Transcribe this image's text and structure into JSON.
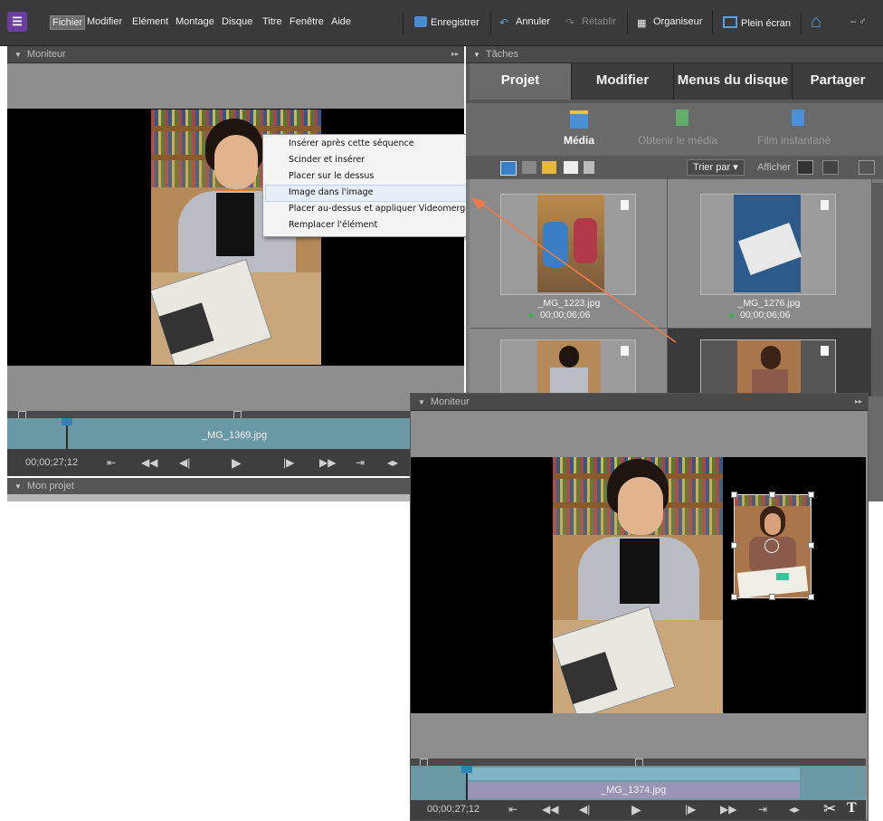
{
  "menubar": {
    "items": [
      "Fichier",
      "Modifier",
      "Elément",
      "Montage",
      "Disque",
      "Titre",
      "Fenêtre",
      "Aide"
    ],
    "active_index": 0,
    "toolbar": {
      "save": "Enregistrer",
      "undo": "Annuler",
      "redo": "Rétablir",
      "organizer": "Organiseur",
      "fullscreen": "Plein écran",
      "window_controls": "– ♂"
    }
  },
  "monitor_panel": {
    "title": "Moniteur",
    "clip_name": "_MG_1369.jpg",
    "timecode": "00;00;27;12"
  },
  "context_menu": {
    "items": [
      "Insérer après cette séquence",
      "Scinder et insérer",
      "Placer sur le dessus",
      "Image dans l'image",
      "Placer au-dessus et appliquer Videomerge",
      "Remplacer l'élément"
    ],
    "highlighted_index": 3
  },
  "project_panel": {
    "title": "Mon projet"
  },
  "tasks_panel": {
    "title": "Tâches",
    "tabs": [
      "Projet",
      "Modifier",
      "Menus du disque",
      "Partager"
    ],
    "selected_tab": 0,
    "subtabs": [
      "Média",
      "Obtenir le média",
      "Film instantané"
    ],
    "sort_label": "Trier par",
    "view_label": "Afficher",
    "thumbnails": [
      {
        "name": "_MG_1223.jpg",
        "duration": "00;00;06;06"
      },
      {
        "name": "_MG_1276.jpg",
        "duration": "00;00;06;06"
      }
    ]
  },
  "monitor2": {
    "title": "Moniteur",
    "clip_name": "_MG_1374.jpg",
    "timecode": "00;00;27;12"
  },
  "colors": {
    "accent_arrow": "#f07a4a",
    "timeline": "#6a98a5",
    "menubar": "#3a3a3a",
    "logo": "#6b3fa0"
  }
}
